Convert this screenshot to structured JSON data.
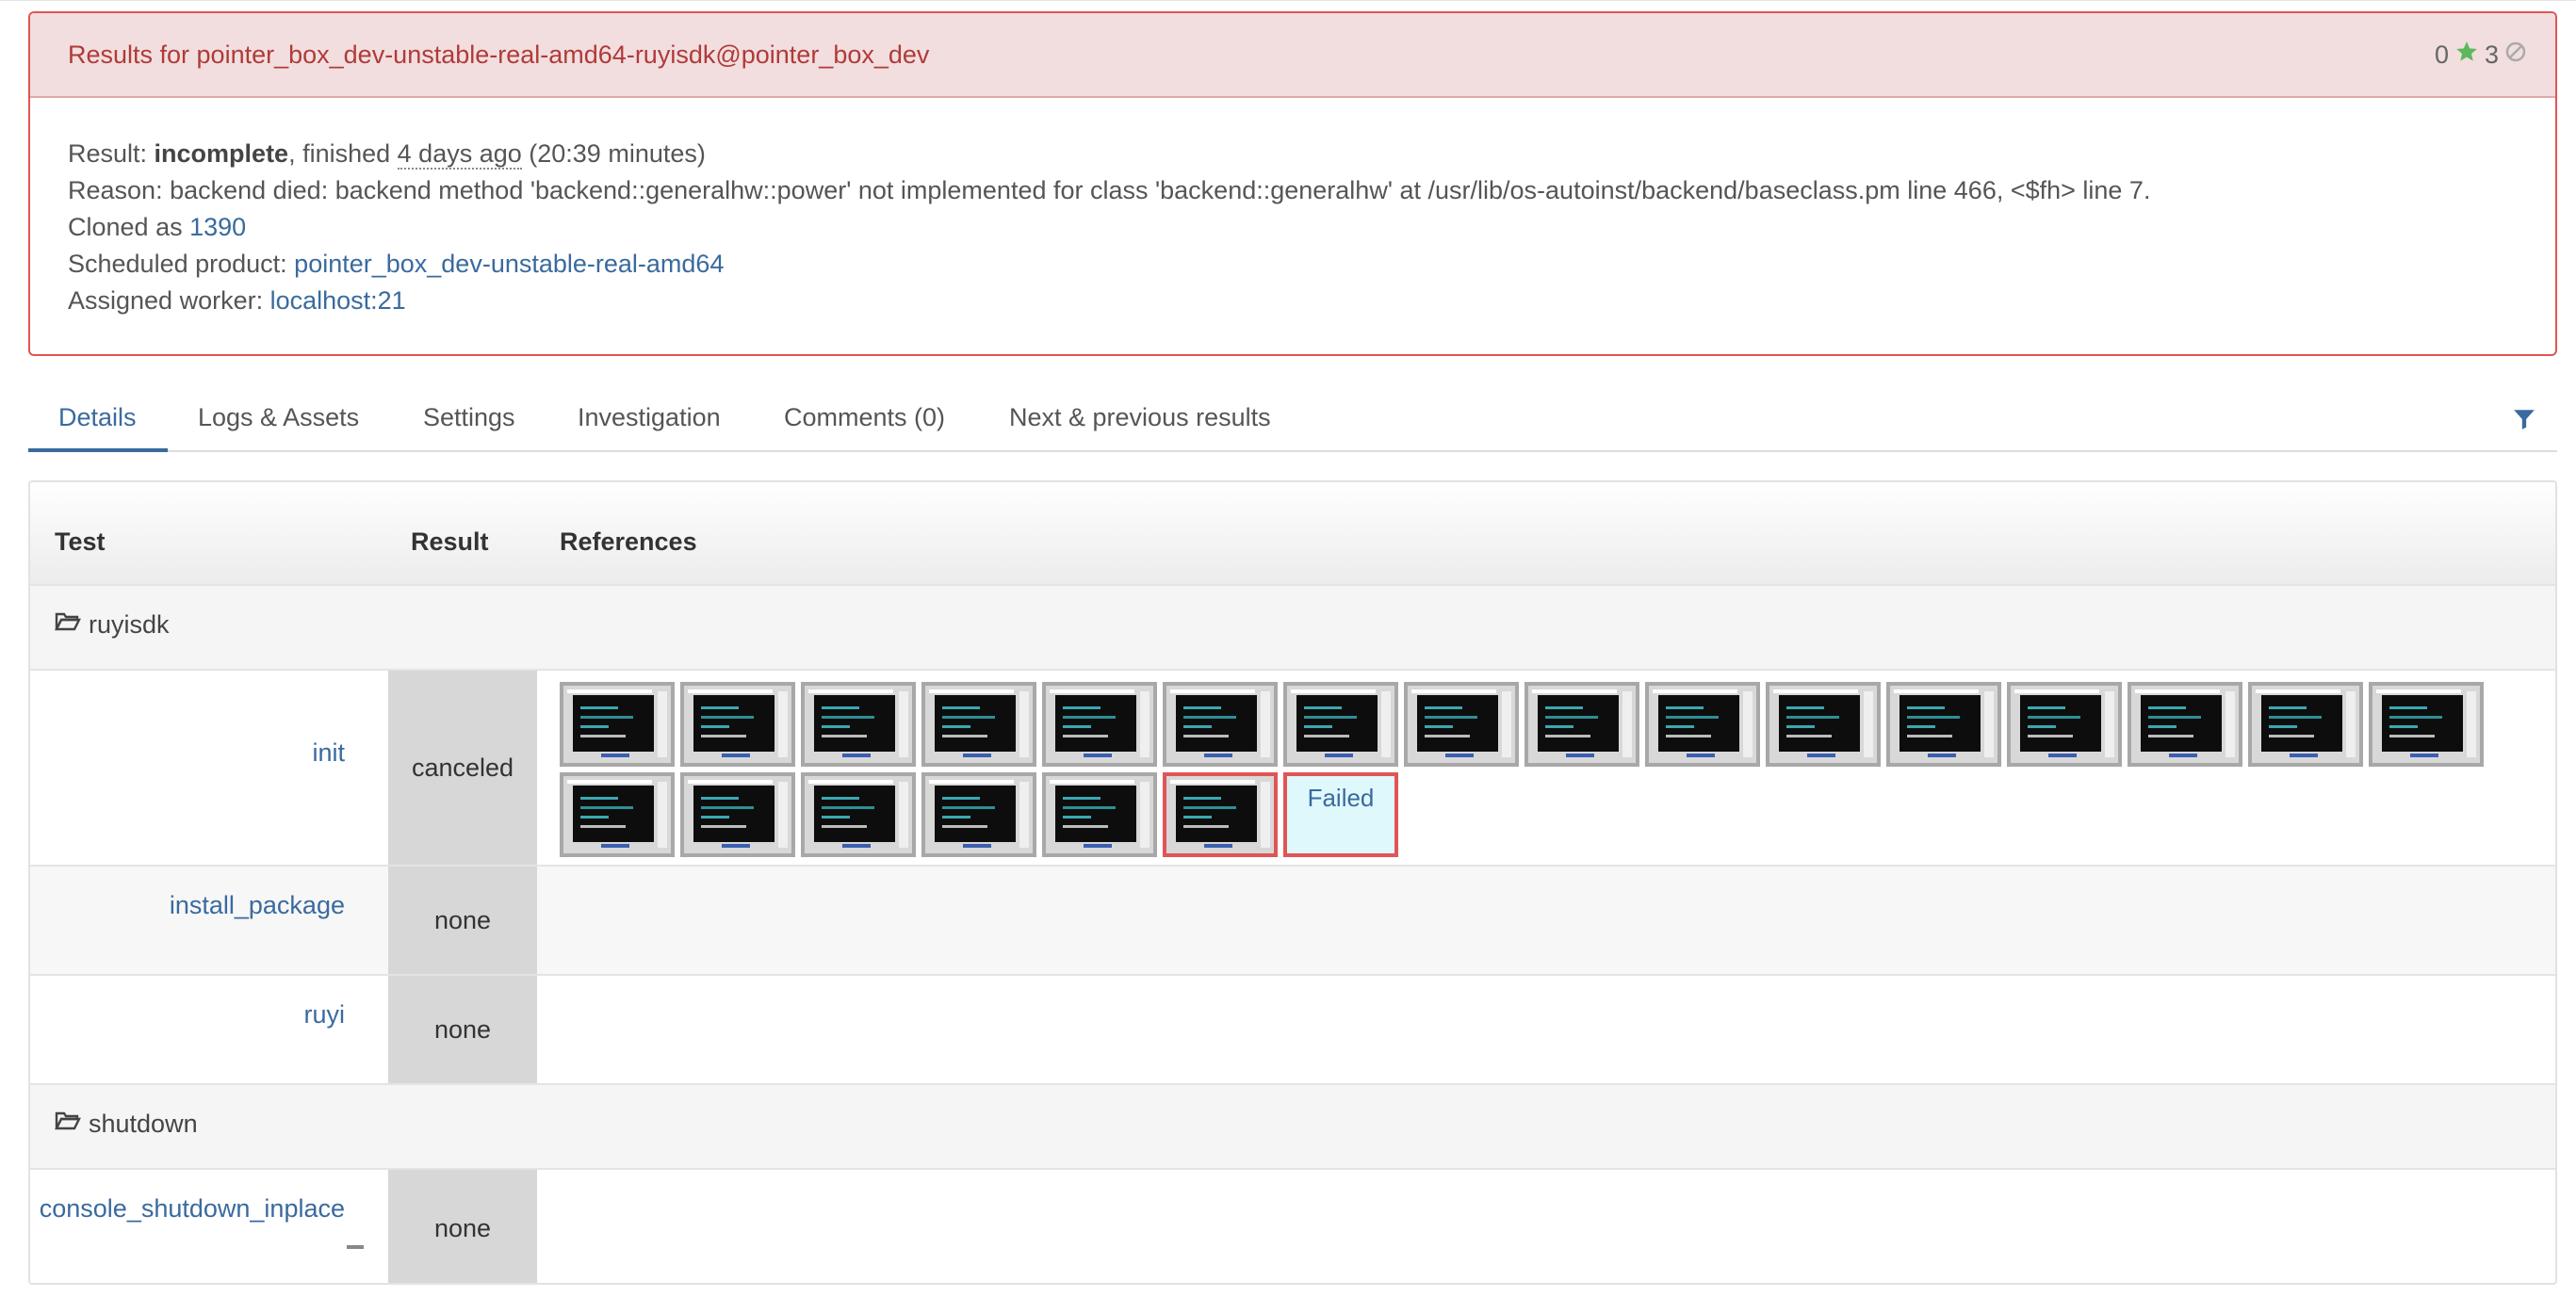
{
  "result_panel": {
    "title": "Results for pointer_box_dev-unstable-real-amd64-ruyisdk@pointer_box_dev",
    "stats": {
      "passed": "0",
      "failed": "3"
    },
    "result_label": "Result: ",
    "result_value": "incomplete",
    "finished_label": ", finished ",
    "finished_ago": "4 days ago",
    "duration": " (20:39 minutes)",
    "reason": "Reason: backend died: backend method 'backend::generalhw::power' not implemented for class 'backend::generalhw' at /usr/lib/os-autoinst/backend/baseclass.pm line 466, <$fh> line 7.",
    "cloned_label": "Cloned as ",
    "cloned_id": "1390",
    "product_label": "Scheduled product: ",
    "product": "pointer_box_dev-unstable-real-amd64",
    "worker_label": "Assigned worker: ",
    "worker": "localhost:21"
  },
  "tabs": {
    "details": "Details",
    "logs": "Logs & Assets",
    "settings": "Settings",
    "investigation": "Investigation",
    "comments": "Comments (0)",
    "next_prev": "Next & previous results"
  },
  "table": {
    "headers": {
      "test": "Test",
      "result": "Result",
      "references": "References"
    },
    "categories": {
      "ruyisdk": "ruyisdk",
      "shutdown": "shutdown"
    },
    "rows": {
      "init": {
        "name": "init",
        "result": "canceled",
        "failed_label": "Failed"
      },
      "install_package": {
        "name": "install_package",
        "result": "none"
      },
      "ruyi": {
        "name": "ruyi",
        "result": "none"
      },
      "console_shutdown_inplace": {
        "name": "console_shutdown_inplace",
        "result": "none"
      }
    }
  },
  "colors": {
    "accent": "#3a6a9e",
    "danger": "#e05555",
    "panel_header_bg": "#f2dede",
    "passed_star": "#5cb85c"
  },
  "icons": [
    "star-icon",
    "ban-icon",
    "filter-icon",
    "folder-open-icon",
    "minus-icon"
  ]
}
